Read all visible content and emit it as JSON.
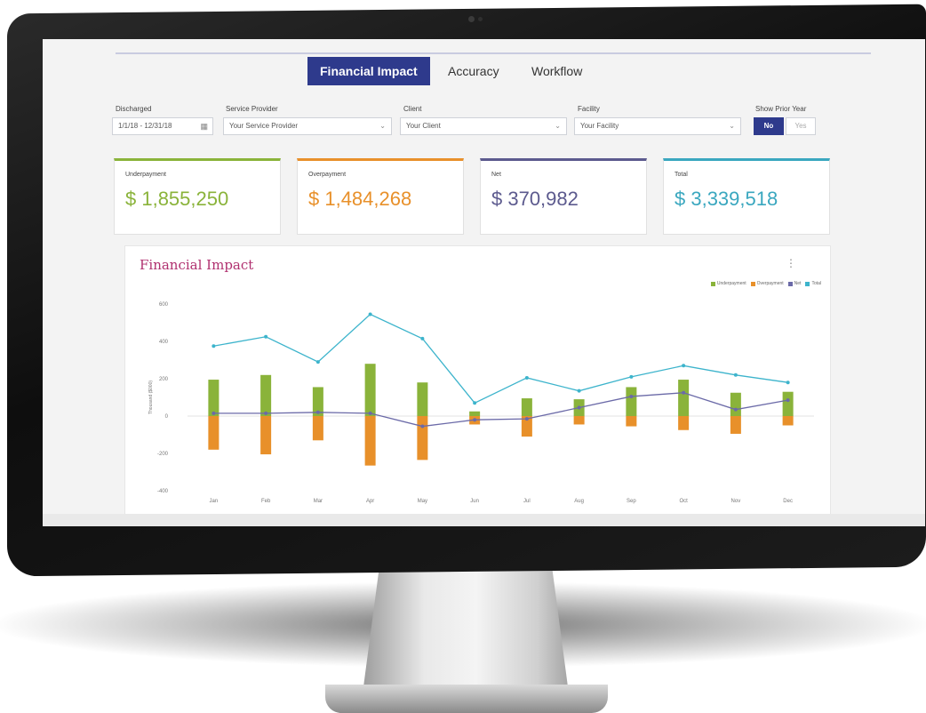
{
  "tabs": [
    {
      "label": "Financial Impact",
      "active": true
    },
    {
      "label": "Accuracy",
      "active": false
    },
    {
      "label": "Workflow",
      "active": false
    }
  ],
  "filters": {
    "discharged": {
      "label": "Discharged",
      "value": "1/1/18 - 12/31/18",
      "icon": "calendar-icon"
    },
    "service_provider": {
      "label": "Service Provider",
      "value": "Your Service Provider"
    },
    "client": {
      "label": "Client",
      "value": "Your Client"
    },
    "facility": {
      "label": "Facility",
      "value": "Your Facility"
    },
    "show_prior_year": {
      "label": "Show Prior Year",
      "options": [
        "No",
        "Yes"
      ],
      "selected": "No"
    }
  },
  "kpis": [
    {
      "title": "Underpayment",
      "value": "$ 1,855,250",
      "color": "#8ab33a"
    },
    {
      "title": "Overpayment",
      "value": "$ 1,484,268",
      "color": "#e8902a"
    },
    {
      "title": "Net",
      "value": "$ 370,982",
      "color": "#5c5a8e"
    },
    {
      "title": "Total",
      "value": "$ 3,339,518",
      "color": "#3aa7bf"
    }
  ],
  "panel": {
    "title": "Financial Impact",
    "menu_icon": "kebab-menu-icon"
  },
  "chart_data": {
    "type": "bar",
    "title": "Financial Impact",
    "ylabel": "Thousand ($000)",
    "ylim": [
      -400,
      600
    ],
    "yticks": [
      600,
      400,
      200,
      0,
      -200,
      -400
    ],
    "categories": [
      "Jan",
      "Feb",
      "Mar",
      "Apr",
      "May",
      "Jun",
      "Jul",
      "Aug",
      "Sep",
      "Oct",
      "Nov",
      "Dec"
    ],
    "legend_position": "top-right",
    "series": [
      {
        "name": "Underpayment",
        "kind": "bar",
        "color": "#8ab33a",
        "values": [
          195,
          220,
          155,
          280,
          180,
          25,
          95,
          90,
          155,
          195,
          125,
          130
        ]
      },
      {
        "name": "Overpayment",
        "kind": "bar",
        "color": "#e8902a",
        "values": [
          -180,
          -205,
          -130,
          -265,
          -235,
          -45,
          -110,
          -45,
          -55,
          -75,
          -95,
          -50
        ]
      },
      {
        "name": "Net",
        "kind": "line",
        "color": "#6b6aa8",
        "values": [
          15,
          15,
          20,
          15,
          -55,
          -20,
          -15,
          45,
          105,
          125,
          35,
          85
        ]
      },
      {
        "name": "Total",
        "kind": "line",
        "color": "#3db4cc",
        "values": [
          375,
          425,
          290,
          545,
          415,
          70,
          205,
          135,
          210,
          270,
          220,
          180
        ]
      }
    ]
  }
}
